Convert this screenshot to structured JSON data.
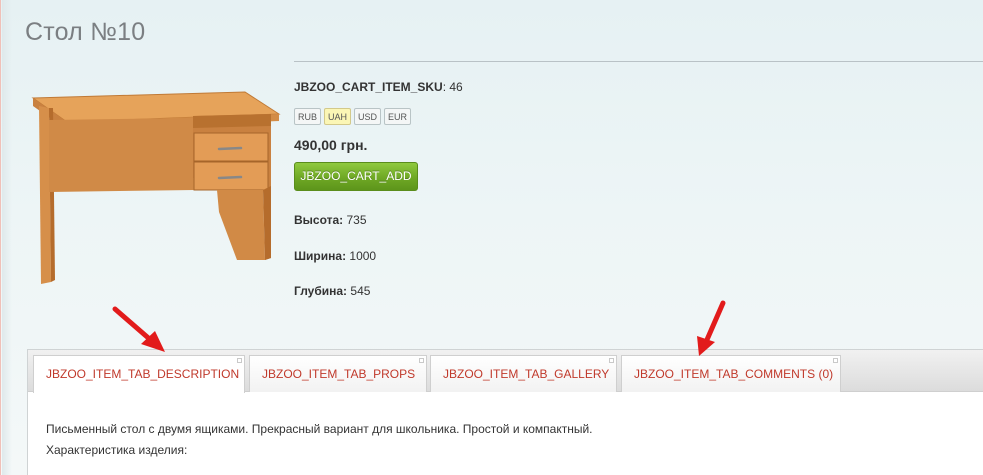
{
  "product": {
    "title": "Стол №10",
    "sku_label": "JBZOO_CART_ITEM_SKU",
    "sku_value": ": 46",
    "currencies": [
      {
        "code": "RUB",
        "active": false
      },
      {
        "code": "UAH",
        "active": true
      },
      {
        "code": "USD",
        "active": false
      },
      {
        "code": "EUR",
        "active": false
      }
    ],
    "price": "490,00 грн.",
    "cart_button_label": "JBZOO_CART_ADD",
    "properties": [
      {
        "label": "Высота:",
        "value": " 735"
      },
      {
        "label": "Ширина:",
        "value": " 1000"
      },
      {
        "label": "Глубина:",
        "value": " 545"
      }
    ]
  },
  "tabs": {
    "items": [
      {
        "label": "JBZOO_ITEM_TAB_DESCRIPTION",
        "active": true
      },
      {
        "label": "JBZOO_ITEM_TAB_PROPS",
        "active": false
      },
      {
        "label": "JBZOO_ITEM_TAB_GALLERY",
        "active": false
      },
      {
        "label": "JBZOO_ITEM_TAB_COMMENTS (0)",
        "active": false
      }
    ],
    "content": {
      "line1": "Письменный стол с двумя ящиками. Прекрасный вариант для школьника. Простой и компактный.",
      "line2": "Характеристика изделия:"
    }
  },
  "colors": {
    "accent_red": "#c0392b",
    "cart_green": "#6fa825",
    "active_currency": "#fbf6b5"
  },
  "icons": {
    "arrow_1": "red-arrow-icon",
    "arrow_2": "red-arrow-icon"
  }
}
